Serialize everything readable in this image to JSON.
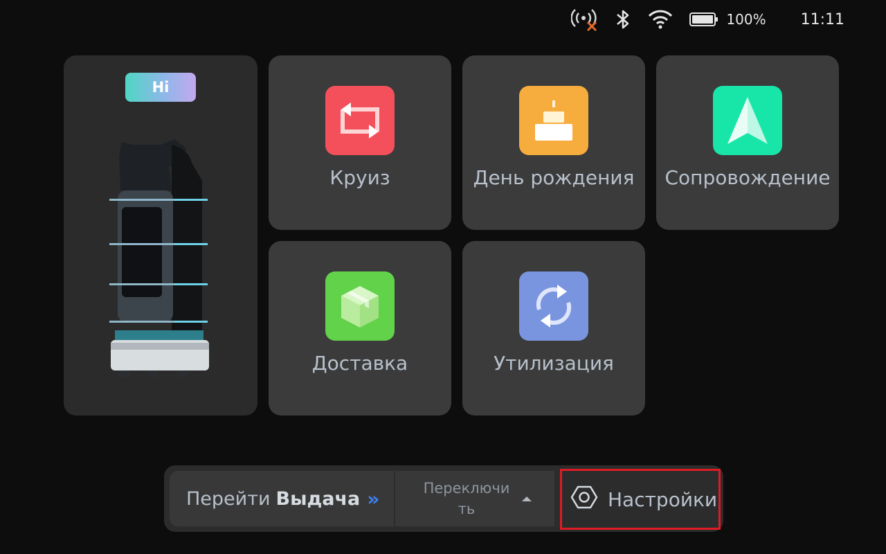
{
  "status_bar": {
    "icons": [
      "remote-signal-off-icon",
      "bluetooth-icon",
      "wifi-icon",
      "battery-icon"
    ],
    "battery_percent": "100%",
    "time": "11:11"
  },
  "robot_card": {
    "badge": "Hi",
    "image": "service-robot-image"
  },
  "tiles": [
    {
      "label": "Круиз",
      "icon": "cruise-icon",
      "color": "#f4505c"
    },
    {
      "label": "День рождения",
      "icon": "birthday-cake-icon",
      "color": "#f7ac3e"
    },
    {
      "label": "Сопровождение",
      "icon": "navigation-arrow-icon",
      "color": "#18e6a8"
    },
    {
      "label": "Доставка",
      "icon": "delivery-box-icon",
      "color": "#62d24a"
    },
    {
      "label": "Утилизация",
      "icon": "recycle-icon",
      "color": "#7a95e0"
    }
  ],
  "bottom_bar": {
    "goto_prefix": "Перейти",
    "goto_target": "Выдача",
    "goto_chevron": "»",
    "switch_label": "Переключи ть",
    "settings_label": "Настройки",
    "settings_icon": "hexagon-settings-icon"
  }
}
